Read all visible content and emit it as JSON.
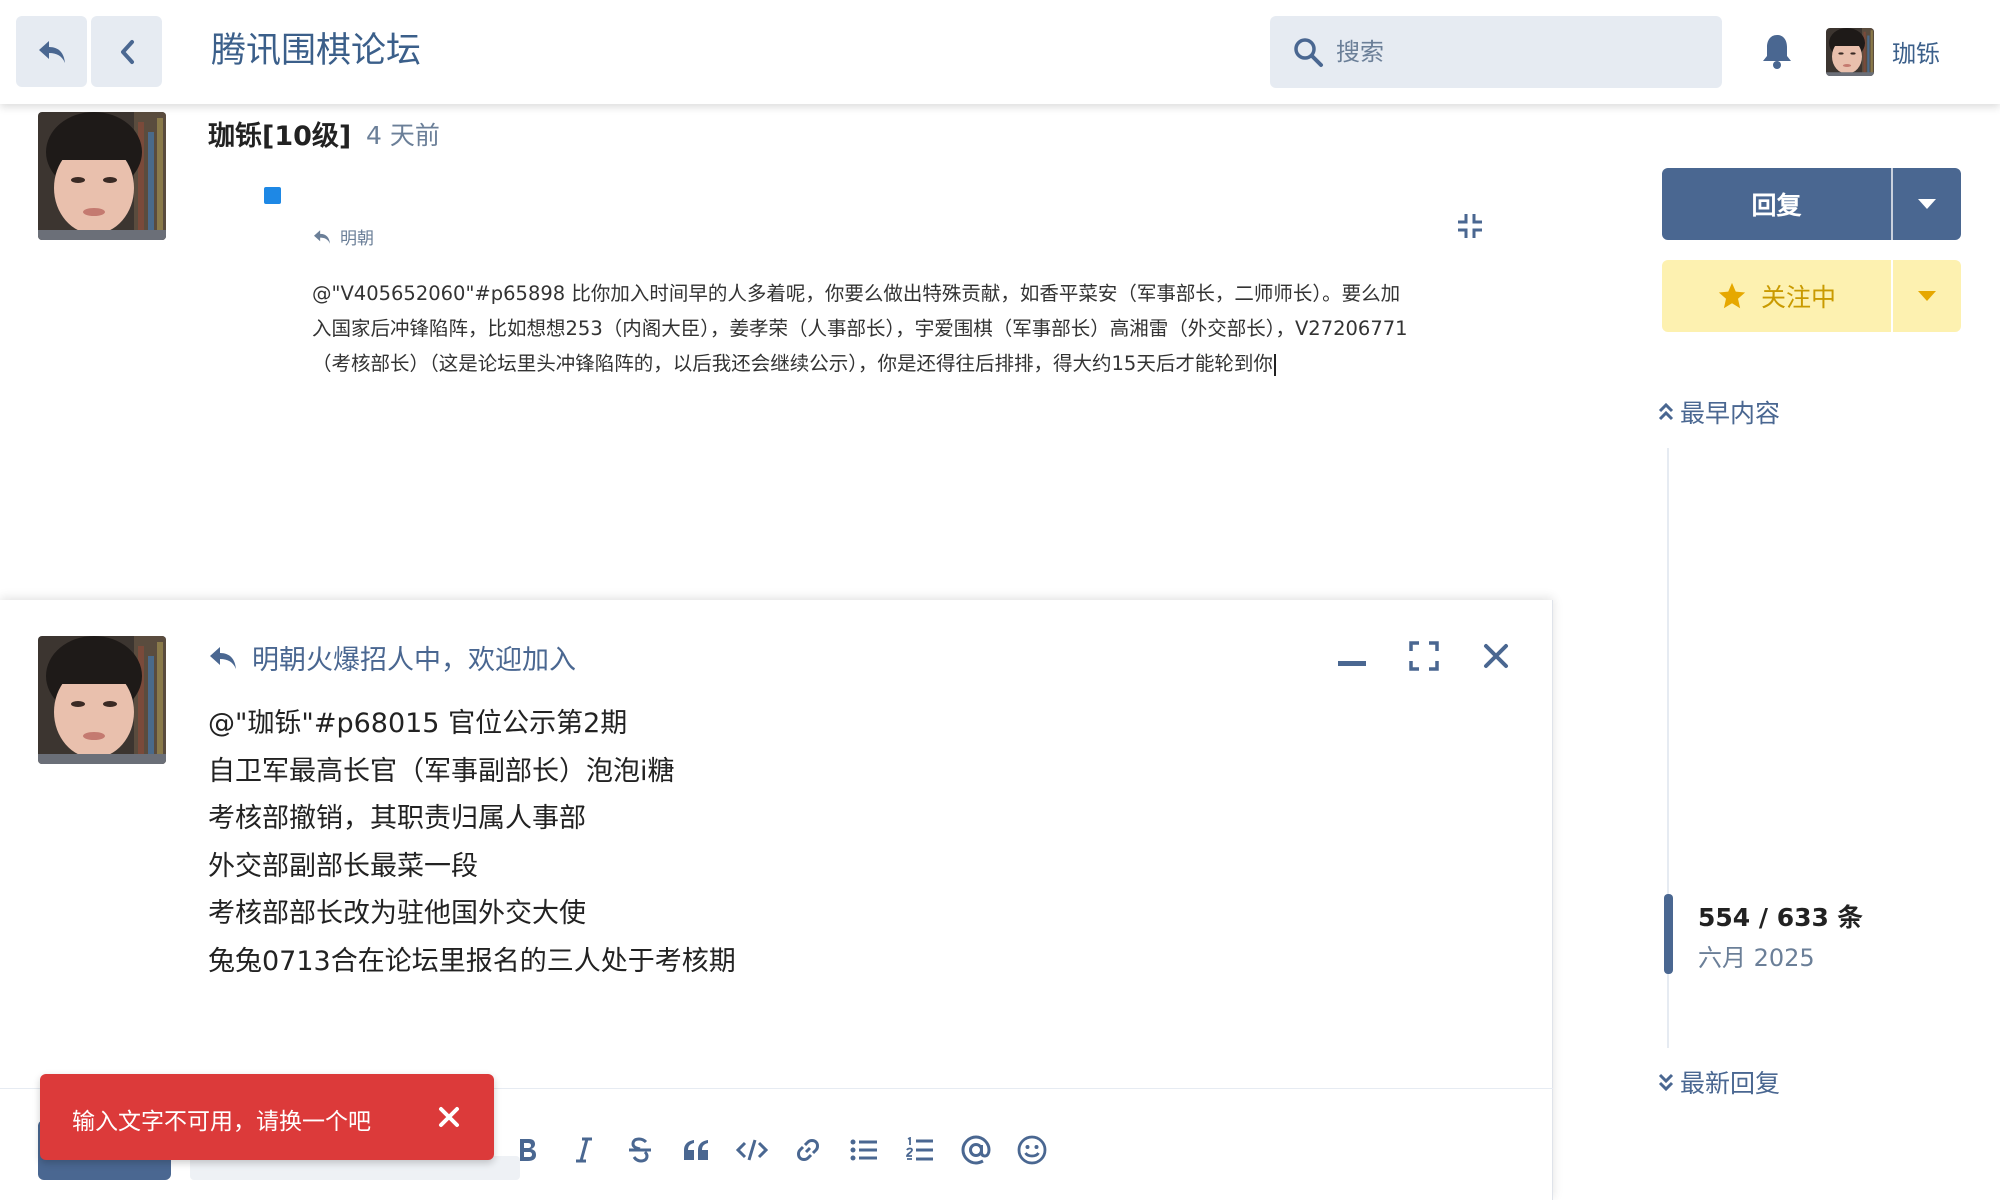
{
  "header": {
    "site_title": "腾讯围棋论坛",
    "search_placeholder": "搜索",
    "username": "珈铄"
  },
  "post": {
    "author": "珈铄[10级]",
    "time": "4 天前",
    "reply_to": "明朝",
    "body": "@\"V405652060\"#p65898 比你加入时间早的人多着呢，你要么做出特殊贡献，如香平菜安（军事部长，二师师长）。要么加入国家后冲锋陷阵，比如想想253（内阁大臣），姜孝荣（人事部长），宇爱围棋（军事部长）高湘雷（外交部长），V27206771（考核部长）（这是论坛里头冲锋陷阵的，以后我还会继续公示），你是还得往后排排，得大约15天后才能轮到你"
  },
  "sidebar": {
    "reply_label": "回复",
    "follow_label": "关注中",
    "timeline_top": "最早内容",
    "timeline_count": "554 / 633 条",
    "timeline_date": "六月 2025",
    "timeline_bottom": "最新回复"
  },
  "composer": {
    "title": "明朝火爆招人中，欢迎加入",
    "lines": [
      "@\"珈铄\"#p68015 官位公示第2期",
      "自卫军最高长官（军事副部长）泡泡i糖",
      "考核部撤销，其职责归属人事部",
      "外交部副部长最菜一段",
      "考核部部长改为驻他国外交大使",
      "兔兔0713合在论坛里报名的三人处于考核期"
    ]
  },
  "toast": {
    "message": "输入文字不可用，请换一个吧"
  },
  "colors": {
    "primary": "#4a6791",
    "title_blue": "#3b5f8a",
    "follow_bg": "#fdf1b0",
    "follow_text": "#c99a00",
    "toast_bg": "#dc3a3a",
    "muted": "#6b7f98"
  }
}
